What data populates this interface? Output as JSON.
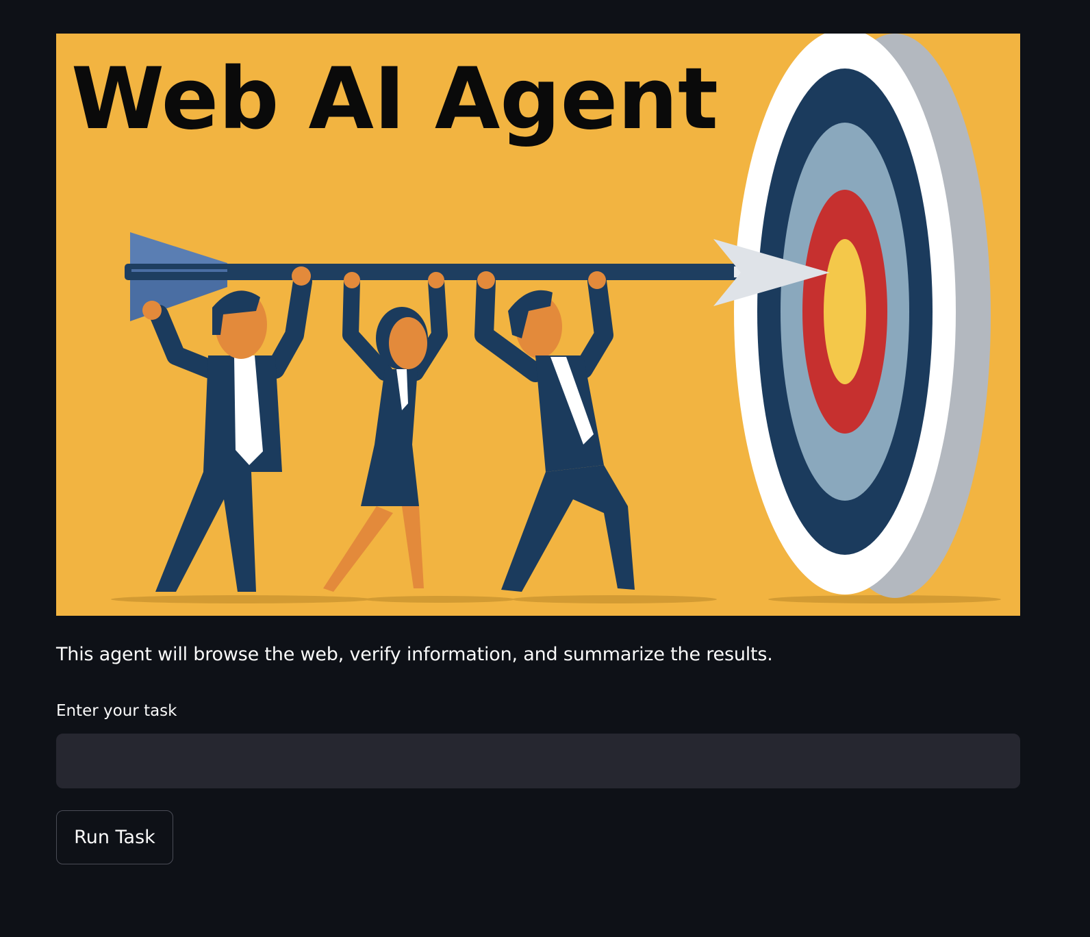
{
  "hero": {
    "title": "Web AI Agent",
    "colors": {
      "background": "#f2b441",
      "navy": "#1b3b5d",
      "skin": "#e38a3b",
      "target_blue": "#8aa8bd",
      "target_red": "#c6302f",
      "target_yellow": "#f4c84a"
    }
  },
  "description": "This agent will browse the web, verify information, and summarize the results.",
  "task": {
    "label": "Enter your task",
    "value": "",
    "placeholder": ""
  },
  "run_button": {
    "label": "Run Task"
  }
}
